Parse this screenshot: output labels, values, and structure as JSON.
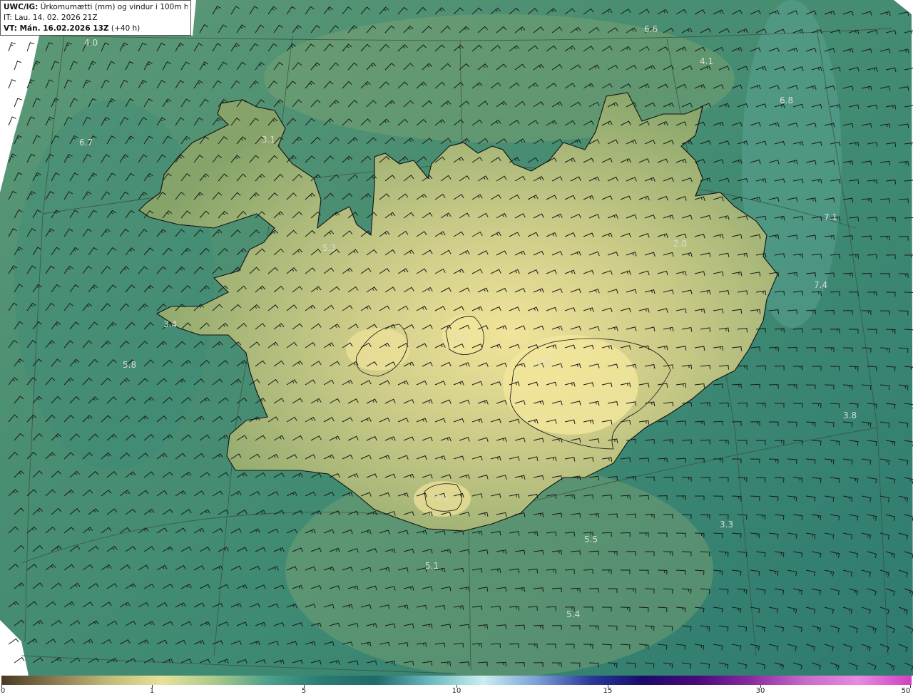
{
  "header": {
    "product": "UWC/IG:",
    "title": "Úrkomumætti (mm) og vindur i 100m hæð",
    "it_label": "IT:",
    "it_value": "Lau. 14. 02. 2026 21Z",
    "vt_label": "VT: Mán. 16.02.2026 13Z",
    "vt_lead": "(+40 h)"
  },
  "value_labels": [
    {
      "text": "6.6"
    },
    {
      "text": "4.0"
    },
    {
      "text": "4.1"
    },
    {
      "text": "6.8"
    },
    {
      "text": "6.7"
    },
    {
      "text": "3.1"
    },
    {
      "text": "7.1"
    },
    {
      "text": "5.3"
    },
    {
      "text": "2.0"
    },
    {
      "text": "7.4"
    },
    {
      "text": "3.4"
    },
    {
      "text": "1.0"
    },
    {
      "text": "0.8"
    },
    {
      "text": "5.8"
    },
    {
      "text": "3.8"
    },
    {
      "text": "0.1"
    },
    {
      "text": "3.3"
    },
    {
      "text": "5.5"
    },
    {
      "text": "5.1"
    },
    {
      "text": "5.4"
    }
  ],
  "colorbar": {
    "ticks": [
      "0",
      "1",
      "5",
      "10",
      "15",
      "30",
      "50"
    ],
    "colors": [
      "#4a3a22",
      "#8a7a50",
      "#c2b978",
      "#e8e19a",
      "#a8c98a",
      "#4aa08a",
      "#2a7a72",
      "#1f6a6a",
      "#6ab8c0",
      "#cbeef0",
      "#7aa0d8",
      "#2a3a98",
      "#1a0a6a",
      "#4a0a7a",
      "#8a2aa0",
      "#c86ac8",
      "#e88ae0",
      "#d040c0"
    ]
  },
  "colors": {
    "sea_dark": "#2f7f72",
    "sea_mid": "#4f9173",
    "land_low": "#8aa86c",
    "land_high": "#eee090",
    "border_line": "#3a4a3a",
    "coastline": "#111111",
    "barb": "#1a1a1a"
  }
}
